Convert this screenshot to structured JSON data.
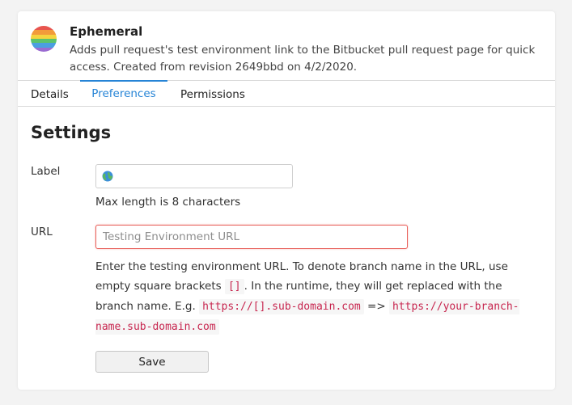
{
  "app": {
    "name": "Ephemeral",
    "description": "Adds pull request's test environment link to the Bitbucket pull request page for quick access. Created from revision 2649bbd on 4/2/2020.",
    "logo_colors": [
      "#e8554e",
      "#f29b3a",
      "#f4d43f",
      "#5cc36b",
      "#4a9fe0",
      "#9a6bd1"
    ]
  },
  "tabs": [
    {
      "label": "Details",
      "active": false
    },
    {
      "label": "Preferences",
      "active": true
    },
    {
      "label": "Permissions",
      "active": false
    }
  ],
  "settings": {
    "title": "Settings",
    "label_field": {
      "label": "Label",
      "value": "",
      "icon": "globe-icon",
      "help": "Max length is 8 characters"
    },
    "url_field": {
      "label": "URL",
      "value": "",
      "placeholder": "Testing Environment URL",
      "help_part1": "Enter the testing environment URL. To denote branch name in the URL, use empty square brackets",
      "code_brackets": "[]",
      "help_part2": ". In the runtime, they will get replaced with the branch name. E.g.",
      "example_from": "https://[].sub-domain.com",
      "arrow": "=>",
      "example_to": "https://your-branch-name.sub-domain.com"
    },
    "save_label": "Save"
  },
  "colors": {
    "accent": "#2684d6",
    "error_border": "#e8605a",
    "code_text": "#c7254e"
  }
}
